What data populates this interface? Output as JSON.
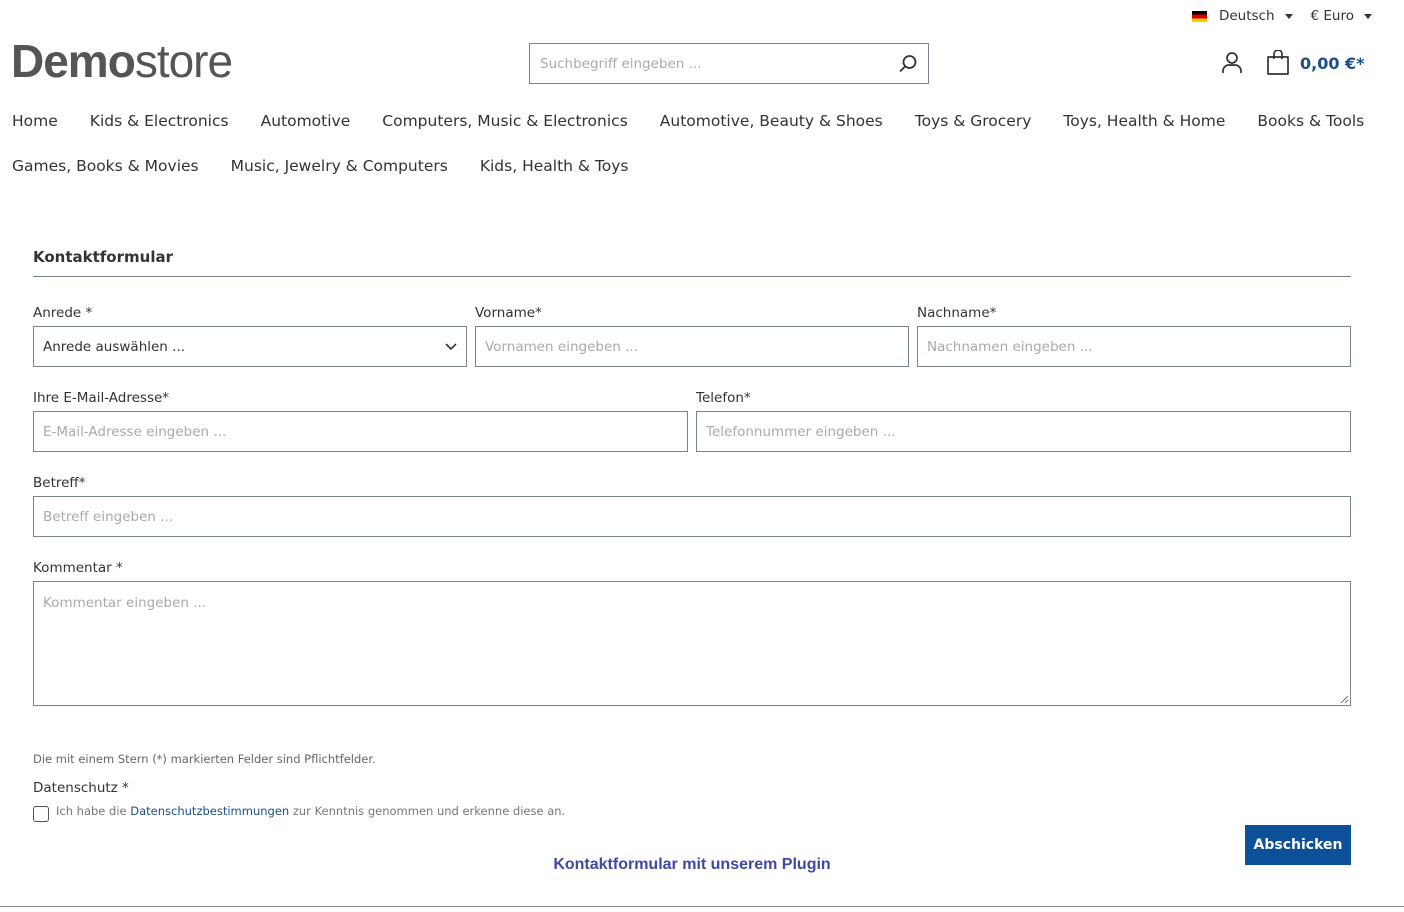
{
  "topbar": {
    "language": "Deutsch",
    "currency": "€ Euro"
  },
  "logo": {
    "bold": "Demo",
    "light": "store"
  },
  "search": {
    "placeholder": "Suchbegriff eingeben ..."
  },
  "cart": {
    "total": "0,00 €*"
  },
  "nav": {
    "row1": [
      "Home",
      "Kids & Electronics",
      "Automotive",
      "Computers, Music & Electronics",
      "Automotive, Beauty & Shoes",
      "Toys & Grocery",
      "Toys, Health & Home",
      "Books & Tools"
    ],
    "row2": [
      "Games, Books & Movies",
      "Music, Jewelry & Computers",
      "Kids, Health & Toys"
    ]
  },
  "form": {
    "title": "Kontaktformular",
    "salutation": {
      "label": "Anrede *",
      "value": "Anrede auswählen ..."
    },
    "firstname": {
      "label": "Vorname*",
      "placeholder": "Vornamen eingeben ..."
    },
    "lastname": {
      "label": "Nachname*",
      "placeholder": "Nachnamen eingeben ..."
    },
    "email": {
      "label": "Ihre E-Mail-Adresse*",
      "placeholder": "E-Mail-Adresse eingeben ..."
    },
    "phone": {
      "label": "Telefon*",
      "placeholder": "Telefonnummer eingeben ..."
    },
    "subject": {
      "label": "Betreff*",
      "placeholder": "Betreff eingeben ..."
    },
    "comment": {
      "label": "Kommentar *",
      "placeholder": "Kommentar eingeben ..."
    },
    "required_note": "Die mit einem Stern (*) markierten Felder sind Pflichtfelder.",
    "privacy": {
      "label": "Datenschutz *",
      "text_before": "Ich habe die ",
      "link": "Datenschutzbestimmungen",
      "text_after": " zur Kenntnis genommen und erkenne diese an.",
      "checked": false
    },
    "submit": "Abschicken"
  },
  "plugin_link": "Kontaktformular mit unserem Plugin"
}
